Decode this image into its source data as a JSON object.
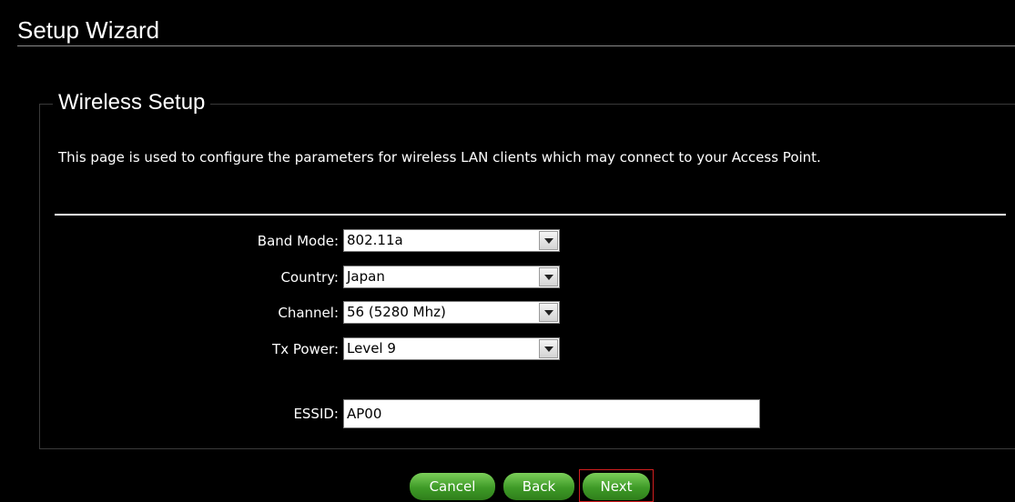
{
  "page": {
    "title": "Setup Wizard"
  },
  "section": {
    "legend": "Wireless Setup",
    "description": "This page is used to configure the parameters for wireless LAN clients which may connect to your Access Point."
  },
  "form": {
    "band_mode": {
      "label": "Band Mode:",
      "value": "802.11a"
    },
    "country": {
      "label": "Country:",
      "value": "Japan"
    },
    "channel": {
      "label": "Channel:",
      "value": "56 (5280 Mhz)"
    },
    "tx_power": {
      "label": "Tx Power:",
      "value": "Level 9"
    },
    "essid": {
      "label": "ESSID:",
      "value": "AP00"
    }
  },
  "buttons": {
    "cancel": "Cancel",
    "back": "Back",
    "next": "Next"
  },
  "colors": {
    "background": "#000000",
    "button_green": "#3e9a27",
    "focus_border": "#d21f1f"
  },
  "icons": {
    "dropdown": "chevron-down-icon"
  }
}
